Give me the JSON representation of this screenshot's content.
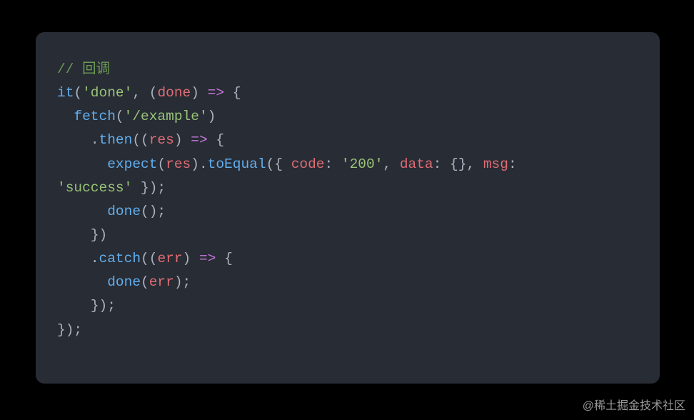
{
  "watermark": "@稀土掘金技术社区",
  "code": {
    "l1_comment": "// 回调",
    "l2_it": "it",
    "l2_lp": "(",
    "l2_str": "'done'",
    "l2_comma": ", ",
    "l2_lp2": "(",
    "l2_done": "done",
    "l2_rp2": ")",
    "l2_arrow": " => ",
    "l2_brace": "{",
    "l3_indent": "  ",
    "l3_fetch": "fetch",
    "l3_lp": "(",
    "l3_str": "'/example'",
    "l3_rp": ")",
    "l4_indent": "    .",
    "l4_then": "then",
    "l4_lp": "((",
    "l4_res": "res",
    "l4_rp": ")",
    "l4_arrow": " => ",
    "l4_brace": "{",
    "l5_indent": "      ",
    "l5_expect": "expect",
    "l5_lp": "(",
    "l5_res": "res",
    "l5_rp_dot": ").",
    "l5_toEqual": "toEqual",
    "l5_lp2": "({ ",
    "l5_code_k": "code",
    "l5_colon1": ": ",
    "l5_code_v": "'200'",
    "l5_comma1": ", ",
    "l5_data_k": "data",
    "l5_colon2": ": {}, ",
    "l5_msg_k": "msg",
    "l5_colon3": ": ",
    "l6_str": "'success'",
    "l6_end": " });",
    "l7_indent": "      ",
    "l7_done": "done",
    "l7_call": "();",
    "l8": "    })",
    "l9_indent": "    .",
    "l9_catch": "catch",
    "l9_lp": "((",
    "l9_err": "err",
    "l9_rp": ")",
    "l9_arrow": " => ",
    "l9_brace": "{",
    "l10_indent": "      ",
    "l10_done": "done",
    "l10_lp": "(",
    "l10_err": "err",
    "l10_rp": ");",
    "l11": "    });",
    "l12": "});"
  }
}
